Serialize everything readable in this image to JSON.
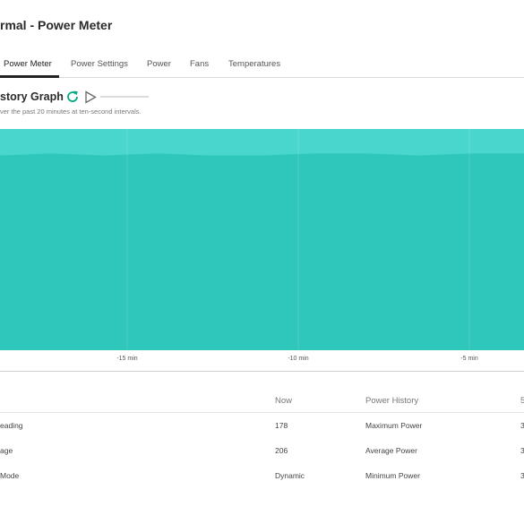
{
  "page": {
    "title": "rmal - Power Meter"
  },
  "tabs": [
    {
      "label": "Power Meter",
      "active": true
    },
    {
      "label": "Power Settings",
      "active": false
    },
    {
      "label": "Power",
      "active": false
    },
    {
      "label": "Fans",
      "active": false
    },
    {
      "label": "Temperatures",
      "active": false
    }
  ],
  "history": {
    "title": "story Graph",
    "subtitle": "ver the past 20 minutes at ten-second intervals.",
    "refresh_icon": "refresh-icon",
    "play_icon": "play-icon"
  },
  "chart_data": {
    "type": "area",
    "x_tick_labels": [
      "-15 min",
      "-10 min",
      "-5 min"
    ],
    "series": [
      {
        "color": "#48d6cd",
        "values": [
          100,
          100,
          100,
          100,
          100,
          100,
          100,
          100,
          100,
          100,
          100
        ]
      },
      {
        "color": "#2fc6bc",
        "values": [
          88,
          89,
          88,
          89,
          88,
          88,
          89,
          89,
          88,
          89,
          89
        ]
      }
    ]
  },
  "table": {
    "headers": {
      "label": "",
      "now": "Now",
      "history": "Power History",
      "extra": "5"
    },
    "rows": [
      {
        "label": "eading",
        "now": "178",
        "history": "Maximum Power",
        "extra": "3"
      },
      {
        "label": "age",
        "now": "206",
        "history": "Average Power",
        "extra": "3"
      },
      {
        "label": "Mode",
        "now": "Dynamic",
        "history": "Minimum Power",
        "extra": "3"
      }
    ]
  },
  "colors": {
    "accent": "#01a982",
    "graph_light": "#48d6cd",
    "graph_dark": "#2fc6bc"
  }
}
